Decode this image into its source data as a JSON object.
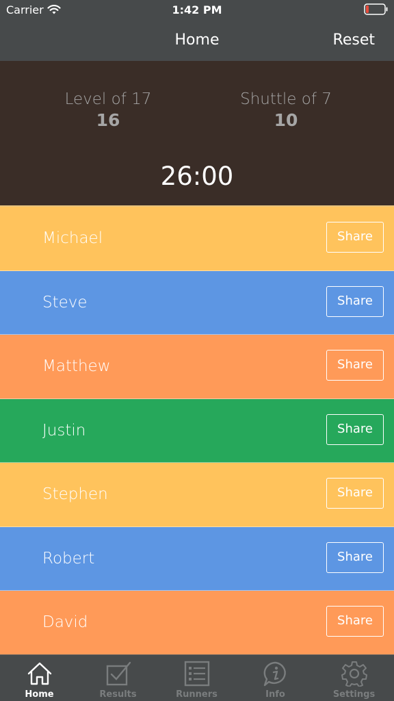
{
  "status_bar": {
    "carrier": "Carrier",
    "time": "1:42 PM",
    "icons": [
      "wifi-icon",
      "battery-icon"
    ],
    "battery_color": "#e74c3c"
  },
  "nav": {
    "title": "Home",
    "reset_label": "Reset"
  },
  "stats": {
    "level_label": "Level of 17",
    "level_value": "16",
    "shuttle_label": "Shuttle of 7",
    "shuttle_value": "10",
    "timer": "26:00"
  },
  "runners": [
    {
      "name": "Michael",
      "share_label": "Share",
      "color": "#ffc35c"
    },
    {
      "name": "Steve",
      "share_label": "Share",
      "color": "#5d96e3"
    },
    {
      "name": "Matthew",
      "share_label": "Share",
      "color": "#ff9a58"
    },
    {
      "name": "Justin",
      "share_label": "Share",
      "color": "#26a85b"
    },
    {
      "name": "Stephen",
      "share_label": "Share",
      "color": "#ffc35c"
    },
    {
      "name": "Robert",
      "share_label": "Share",
      "color": "#5d96e3"
    },
    {
      "name": "David",
      "share_label": "Share",
      "color": "#ff9a58"
    }
  ],
  "tabs": [
    {
      "label": "Home",
      "icon": "home-icon",
      "active": true
    },
    {
      "label": "Results",
      "icon": "results-icon",
      "active": false
    },
    {
      "label": "Runners",
      "icon": "runners-icon",
      "active": false
    },
    {
      "label": "Info",
      "icon": "info-icon",
      "active": false
    },
    {
      "label": "Settings",
      "icon": "settings-icon",
      "active": false
    }
  ],
  "colors": {
    "nav_background": "#474a4b",
    "stats_background": "#3a2d27",
    "stats_text": "#a6a6a6",
    "tab_inactive": "#7a7d7e",
    "tab_active": "#ffffff"
  }
}
